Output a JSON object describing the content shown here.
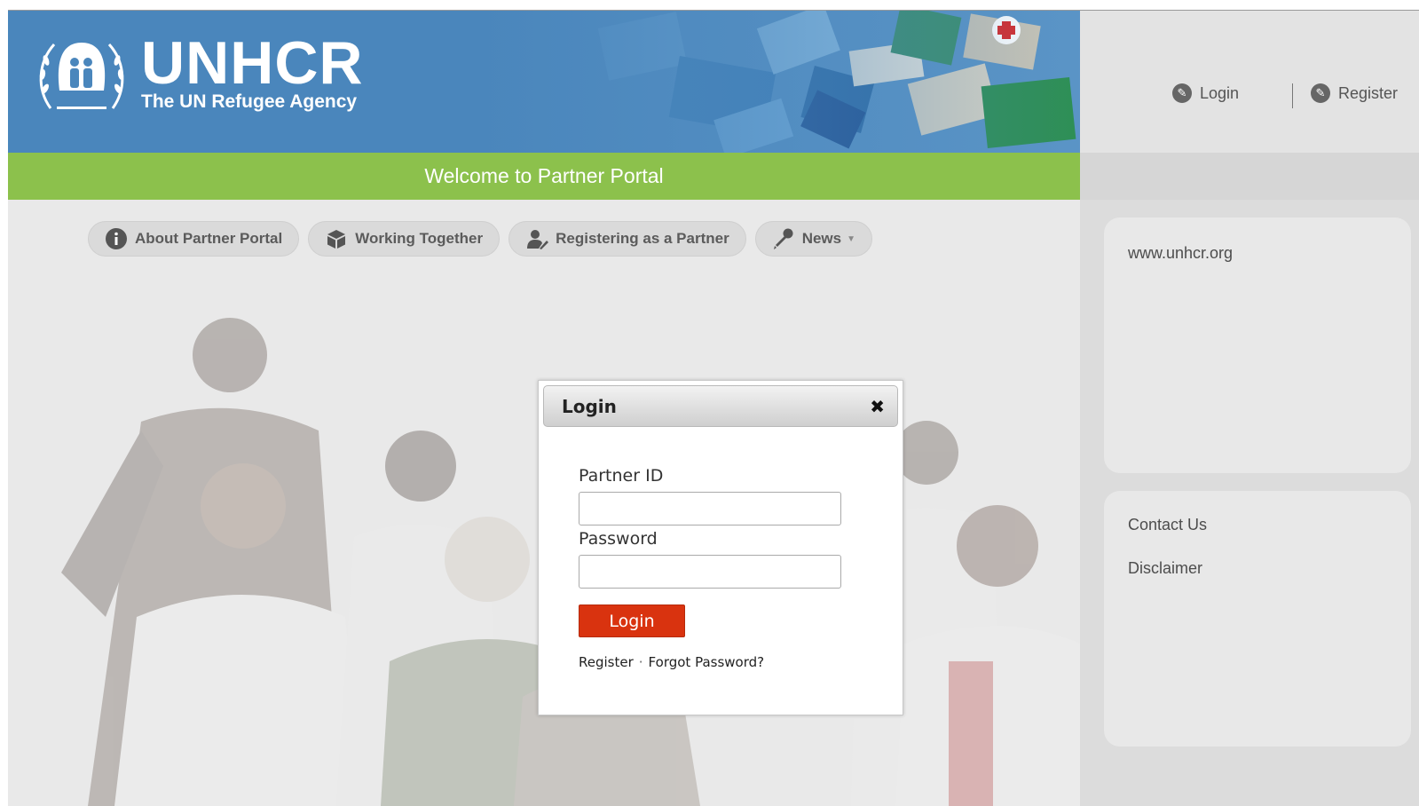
{
  "header": {
    "logo_name": "UNHCR",
    "logo_tagline": "The UN Refugee Agency",
    "welcome": "Welcome to Partner Portal",
    "account": {
      "login_label": "Login",
      "register_label": "Register"
    }
  },
  "nav": [
    {
      "label": "About Partner Portal",
      "icon": "info-icon"
    },
    {
      "label": "Working Together",
      "icon": "box-icon"
    },
    {
      "label": "Registering as a Partner",
      "icon": "user-pen-icon"
    },
    {
      "label": "News",
      "icon": "microphone-icon",
      "has_dropdown": true
    }
  ],
  "sidebar": {
    "panel1_links": [
      "www.unhcr.org"
    ],
    "panel2_links": [
      "Contact Us",
      "Disclaimer"
    ]
  },
  "login_modal": {
    "title": "Login",
    "partner_id_label": "Partner ID",
    "partner_id_value": "",
    "password_label": "Password",
    "password_value": "",
    "submit_label": "Login",
    "register_link": "Register",
    "separator": "·",
    "forgot_link": "Forgot Password?"
  },
  "colors": {
    "banner_blue": "#4a86bc",
    "welcome_green": "#8cc14c",
    "login_button_red": "#d9330f",
    "sidebar_gray": "#dcdcdc"
  }
}
